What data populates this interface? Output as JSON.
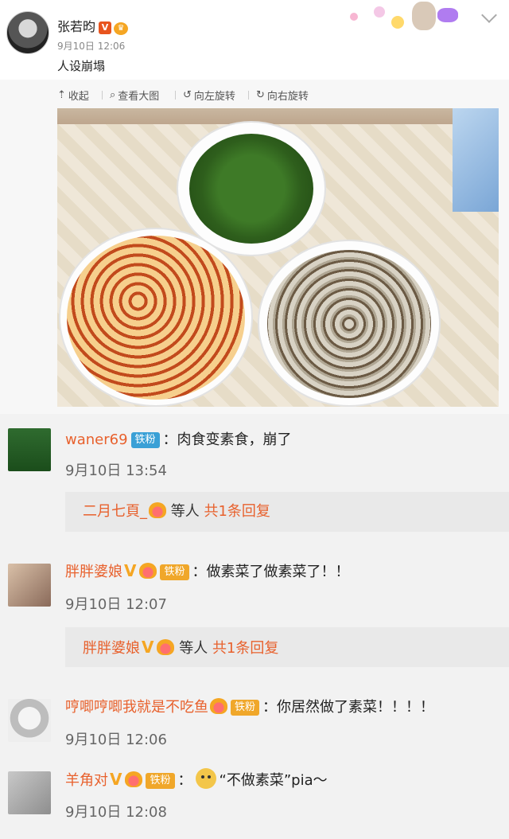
{
  "post": {
    "username": "张若昀",
    "time": "9月10日 12:06",
    "text": "人设崩塌"
  },
  "toolbar": {
    "collapse": "收起",
    "view_large": "查看大图",
    "rotate_left": "向左旋转",
    "rotate_right": "向右旋转"
  },
  "comments": [
    {
      "name": "waner69",
      "badge": "铁粉",
      "text": "：肉食变素食，崩了",
      "time": "9月10日 13:54",
      "reply": {
        "name": "二月七頁_",
        "mid": " 等人 ",
        "count": "共1条回复"
      }
    },
    {
      "name": "胖胖婆娘",
      "badge": "铁粉",
      "text": "：做素菜了做素菜了！！",
      "time": "9月10日 12:07",
      "reply": {
        "name": "胖胖婆娘",
        "mid": " 等人 ",
        "count": "共1条回复"
      }
    },
    {
      "name": "哼唧哼唧我就是不吃鱼",
      "badge": "铁粉",
      "text": "：你居然做了素菜！！！！",
      "time": "9月10日 12:06"
    },
    {
      "name": "羊角对",
      "badge": "铁粉",
      "text": "“不做素菜”pia～",
      "time": "9月10日 12:08"
    }
  ]
}
